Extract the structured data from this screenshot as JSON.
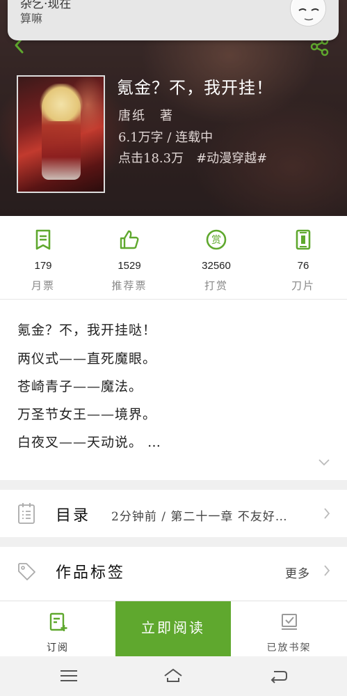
{
  "notification": {
    "title": "杂乞·现在",
    "body": "算嘛"
  },
  "book": {
    "title": "氪金？不，我开挂！",
    "author": "唐纸　著",
    "meta": "6.1万字 / 连载中",
    "clicks": "点击18.3万　#动漫穿越#"
  },
  "stats": [
    {
      "icon": "monthly-ticket-icon",
      "value": "179",
      "label": "月票"
    },
    {
      "icon": "thumbs-up-icon",
      "value": "1529",
      "label": "推荐票"
    },
    {
      "icon": "reward-icon",
      "value": "32560",
      "label": "打赏"
    },
    {
      "icon": "blade-icon",
      "value": "76",
      "label": "刀片"
    }
  ],
  "description": {
    "lines": [
      "氪金？不，我开挂哒！",
      "两仪式——直死魔眼。",
      "苍崎青子——魔法。",
      "万圣节女王——境界。",
      "白夜叉——天动说。 …"
    ]
  },
  "catalog": {
    "title": "目录",
    "latest": "2分钟前 / 第二十一章 不友好…"
  },
  "tags": {
    "title": "作品标签",
    "more": "更多"
  },
  "actions": {
    "subscribe": "订阅",
    "read_now": "立即阅读",
    "on_shelf": "已放书架"
  },
  "colors": {
    "accent": "#5fa82e",
    "text_muted": "#888888"
  }
}
